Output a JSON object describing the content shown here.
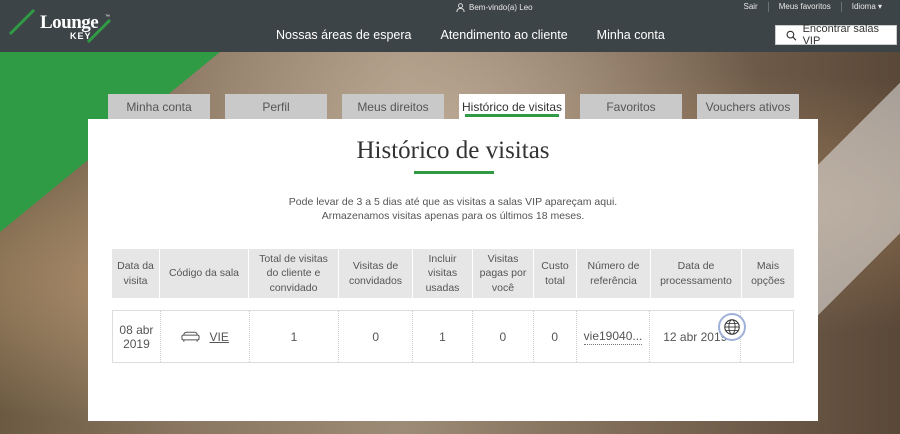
{
  "header": {
    "logo_text": "Lounge",
    "logo_sub": "KEY",
    "logo_tm": "™",
    "welcome": "Bem-vindo(a) Leo",
    "top_links": [
      "Sair",
      "Meus favoritos",
      "Idioma ▾"
    ],
    "nav": [
      "Nossas áreas de espera",
      "Atendimento ao cliente",
      "Minha conta"
    ],
    "search_label": "Encontrar salas VIP"
  },
  "tabs": [
    {
      "label": "Minha conta",
      "active": false
    },
    {
      "label": "Perfil",
      "active": false
    },
    {
      "label": "Meus direitos",
      "active": false
    },
    {
      "label": "Histórico de visitas",
      "active": true
    },
    {
      "label": "Favoritos",
      "active": false
    },
    {
      "label": "Vouchers ativos",
      "active": false
    }
  ],
  "page": {
    "title": "Histórico de visitas",
    "info_line1": "Pode levar de 3 a 5 dias até que as visitas a salas VIP apareçam aqui.",
    "info_line2": "Armazenamos visitas apenas para os últimos 18 meses."
  },
  "table": {
    "headers": [
      "Data da visita",
      "Código da sala",
      "Total de visitas do cliente e convidado",
      "Visitas de convidados",
      "Incluir visitas usadas",
      "Visitas pagas por você",
      "Custo total",
      "Número de referência",
      "Data de processamento",
      "Mais opções"
    ],
    "rows": [
      {
        "date": "08 abr 2019",
        "lounge_code": "VIE",
        "total_visits": "1",
        "guest_visits": "0",
        "included_visits": "1",
        "paid_visits": "0",
        "total_cost": "0",
        "reference": "vie19040...",
        "processing_date": "12 abr 2019"
      }
    ]
  },
  "colors": {
    "header_bg": "#3d4447",
    "accent_green": "#2f9b45",
    "tab_inactive": "#c9c9c9"
  }
}
